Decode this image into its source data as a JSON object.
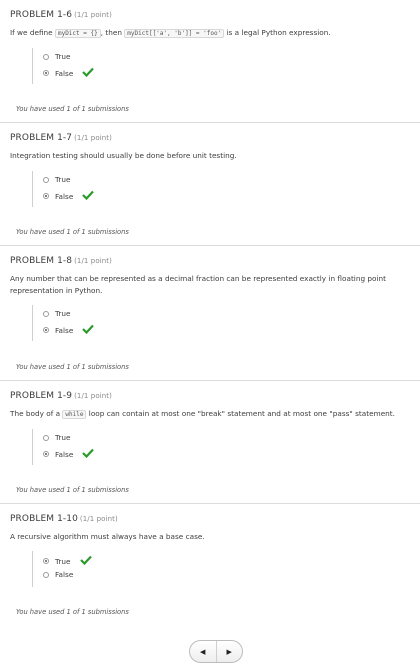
{
  "problems": [
    {
      "title": "PROBLEM 1-6",
      "points": "(1/1 point)",
      "q_pre": "If we define ",
      "code1": "myDict = {}",
      "q_mid": ", then ",
      "code2": "myDict[['a', 'b']] = 'foo'",
      "q_post": " is a legal Python expression.",
      "choices": [
        "True",
        "False"
      ],
      "selected": "False",
      "submissions": "You have used 1 of 1 submissions"
    },
    {
      "title": "PROBLEM 1-7",
      "points": "(1/1 point)",
      "question": "Integration testing should usually be done before unit testing.",
      "choices": [
        "True",
        "False"
      ],
      "selected": "False",
      "submissions": "You have used 1 of 1 submissions"
    },
    {
      "title": "PROBLEM 1-8",
      "points": "(1/1 point)",
      "question": "Any number that can be represented as a decimal fraction can be represented exactly in floating point representation in Python.",
      "choices": [
        "True",
        "False"
      ],
      "selected": "False",
      "submissions": "You have used 1 of 1 submissions"
    },
    {
      "title": "PROBLEM 1-9",
      "points": "(1/1 point)",
      "q_pre": "The body of a ",
      "code1": "while",
      "q_post": " loop can contain at most one \"break\" statement and at most one \"pass\" statement.",
      "choices": [
        "True",
        "False"
      ],
      "selected": "False",
      "submissions": "You have used 1 of 1 submissions"
    },
    {
      "title": "PROBLEM 1-10",
      "points": "(1/1 point)",
      "question": "A recursive algorithm must always have a base case.",
      "choices": [
        "True",
        "False"
      ],
      "selected": "True",
      "submissions": "You have used 1 of 1 submissions"
    }
  ],
  "pager": {
    "prev": "◀",
    "next": "▶"
  },
  "colors": {
    "correct": "#2a9a2a"
  }
}
